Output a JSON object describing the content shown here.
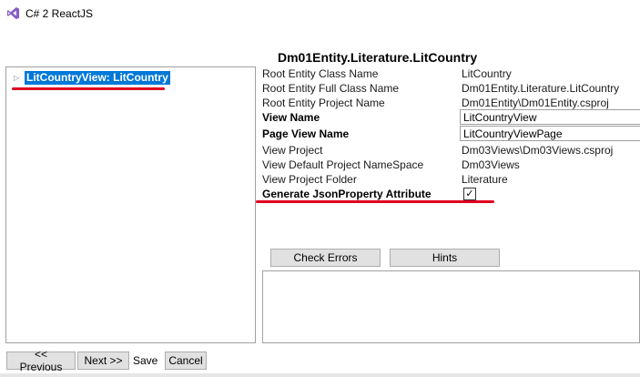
{
  "window": {
    "title": "C# 2 ReactJS",
    "icon": "visual-studio-icon"
  },
  "heading": "Dm01Entity.Literature.LitCountry",
  "tree": {
    "items": [
      {
        "label": "LitCountryView: LitCountry",
        "expander_icon": "triangle-right-icon"
      }
    ]
  },
  "properties": {
    "root_entity_class_name": {
      "label": "Root Entity Class Name",
      "value": "LitCountry"
    },
    "root_entity_full_class_name": {
      "label": "Root Entity Full Class Name",
      "value": "Dm01Entity.Literature.LitCountry"
    },
    "root_entity_project_name": {
      "label": "Root Entity Project Name",
      "value": "Dm01Entity\\Dm01Entity.csproj"
    },
    "view_name": {
      "label": "View Name",
      "value": "LitCountryView"
    },
    "page_view_name": {
      "label": "Page View Name",
      "value": "LitCountryViewPage"
    },
    "view_project": {
      "label": "View Project",
      "value": "Dm03Views\\Dm03Views.csproj"
    },
    "view_default_namespace": {
      "label": "View Default Project NameSpace",
      "value": "Dm03Views"
    },
    "view_project_folder": {
      "label": "View Project Folder",
      "value": "Literature"
    },
    "generate_json_property": {
      "label": "Generate JsonProperty Attribute",
      "checked": true,
      "check_glyph": "✓"
    }
  },
  "actions": {
    "check_errors": "Check Errors",
    "hints": "Hints"
  },
  "navigation": {
    "previous": "<< Previous",
    "next": "Next >>",
    "save": "Save",
    "cancel": "Cancel"
  },
  "colors": {
    "selection": "#0078d7",
    "annotation": "#e00021"
  }
}
